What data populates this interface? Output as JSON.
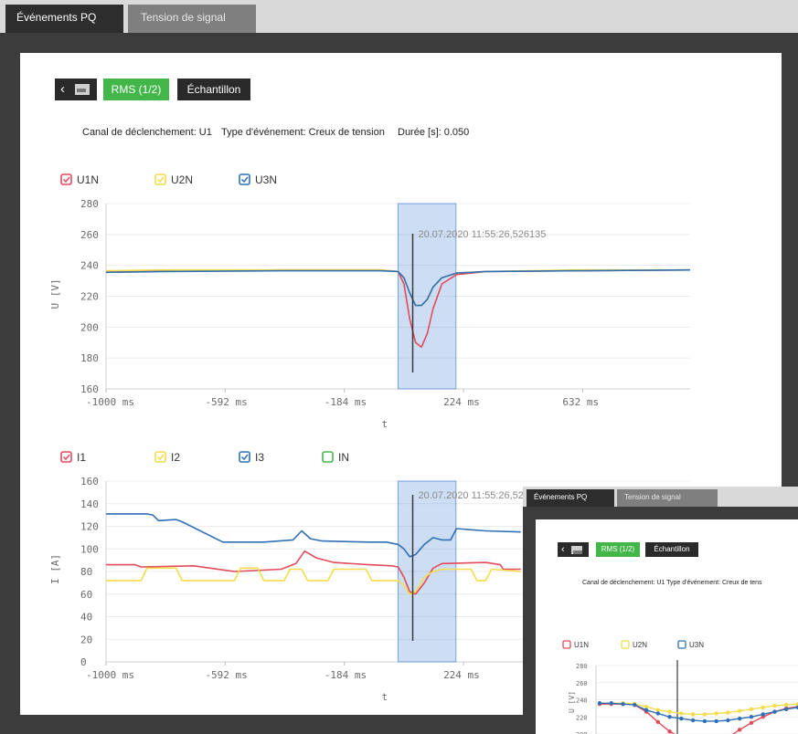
{
  "tabs": [
    {
      "label": "Événements PQ",
      "active": true
    },
    {
      "label": "Tension de signal",
      "active": false
    }
  ],
  "toolbar": {
    "rms_label": "RMS (1/2)",
    "sample_label": "Échantillon"
  },
  "info": {
    "trigger_channel": "Canal de déclenchement: U1",
    "event_type": "Type d'événement: Creux de tension",
    "duration": "Durée [s]: 0.050"
  },
  "colors": {
    "u1n": "#e34a5a",
    "u2n": "#f4dc4a",
    "u3n": "#2f6fb5",
    "in": "#46b649",
    "highlight": "#4a86d8"
  },
  "chart_data": [
    {
      "type": "line",
      "legend": [
        "U1N",
        "U2N",
        "U3N"
      ],
      "ylabel": "U [V]",
      "xlabel": "t",
      "ylim": [
        160,
        280
      ],
      "yticks": [
        160,
        180,
        200,
        220,
        240,
        260,
        280
      ],
      "xlim": [
        -1000,
        1000
      ],
      "xticks": [
        "-1000 ms",
        "-592 ms",
        "-184 ms",
        "224 ms",
        "632 ms"
      ],
      "xtick_values": [
        -1000,
        -592,
        -184,
        224,
        632
      ],
      "highlight_x": [
        0,
        198
      ],
      "annotation": "20.07.2020 11:55:26,526135",
      "series": [
        {
          "name": "U1N",
          "x": [
            -1000,
            -800,
            -400,
            -60,
            0,
            20,
            40,
            60,
            80,
            100,
            120,
            150,
            200,
            300,
            600,
            1000
          ],
          "values": [
            236,
            236.5,
            237,
            237,
            236,
            228,
            205,
            190,
            187,
            196,
            212,
            228,
            234,
            236,
            236.5,
            237
          ]
        },
        {
          "name": "U2N",
          "x": [
            -1000,
            -800,
            -400,
            -60,
            0,
            20,
            40,
            60,
            80,
            100,
            120,
            150,
            200,
            300,
            600,
            1000
          ],
          "values": [
            236.5,
            237,
            237,
            237,
            236,
            232,
            222,
            214,
            214,
            218,
            226,
            232,
            235,
            236,
            237,
            237
          ]
        },
        {
          "name": "U3N",
          "x": [
            -1000,
            -800,
            -400,
            -60,
            0,
            20,
            40,
            60,
            80,
            100,
            120,
            150,
            200,
            300,
            600,
            1000
          ],
          "values": [
            235.5,
            236,
            236.5,
            236.5,
            236,
            232,
            222,
            214,
            214,
            218,
            226,
            232,
            235,
            236,
            236.5,
            237
          ]
        }
      ]
    },
    {
      "type": "line",
      "legend": [
        "I1",
        "I2",
        "I3",
        "IN"
      ],
      "ylabel": "I [A]",
      "xlabel": "t",
      "ylim": [
        0,
        160
      ],
      "yticks": [
        0,
        20,
        40,
        60,
        80,
        100,
        120,
        140,
        160
      ],
      "xlim": [
        -1000,
        1000
      ],
      "xticks": [
        "-1000 ms",
        "-592 ms",
        "-184 ms",
        "224 ms"
      ],
      "xtick_values": [
        -1000,
        -592,
        -184,
        224
      ],
      "highlight_x": [
        0,
        198
      ],
      "annotation": "20.07.2020 11:55:26,526",
      "series": [
        {
          "name": "I1",
          "x": [
            -1000,
            -900,
            -880,
            -700,
            -560,
            -400,
            -350,
            -320,
            -280,
            -220,
            -100,
            -20,
            0,
            20,
            40,
            60,
            90,
            120,
            150,
            300,
            350,
            360,
            420
          ],
          "values": [
            86,
            86,
            84,
            85,
            80,
            82,
            87,
            98,
            92,
            88,
            86,
            85,
            84,
            75,
            62,
            60,
            70,
            83,
            87,
            88,
            86,
            82,
            82
          ]
        },
        {
          "name": "I2",
          "x": [
            -1000,
            -880,
            -860,
            -760,
            -740,
            -560,
            -540,
            -480,
            -460,
            -390,
            -370,
            -330,
            -310,
            -240,
            -220,
            -110,
            -90,
            -20,
            0,
            20,
            40,
            60,
            90,
            120,
            150,
            250,
            270,
            300,
            320,
            420
          ],
          "values": [
            72,
            72,
            83,
            83,
            72,
            72,
            83,
            83,
            72,
            72,
            82,
            82,
            72,
            72,
            82,
            82,
            72,
            72,
            72,
            68,
            60,
            62,
            75,
            80,
            82,
            82,
            72,
            72,
            82,
            80
          ]
        },
        {
          "name": "I3",
          "x": [
            -1000,
            -860,
            -840,
            -820,
            -760,
            -740,
            -600,
            -460,
            -360,
            -330,
            -300,
            -260,
            -100,
            -40,
            0,
            20,
            40,
            60,
            90,
            120,
            150,
            180,
            200,
            300,
            420
          ],
          "values": [
            131,
            131,
            130,
            125,
            126,
            124,
            106,
            106,
            108,
            116,
            109,
            107,
            106,
            106,
            104,
            100,
            93,
            95,
            104,
            110,
            108,
            108,
            118,
            116,
            115
          ]
        }
      ]
    }
  ],
  "inset": {
    "tabs": [
      {
        "label": "Événements PQ"
      },
      {
        "label": "Tension de signal"
      }
    ],
    "toolbar": {
      "rms_label": "RMS (1/2)",
      "sample_label": "Échantillon"
    },
    "info": "Canal de déclenchement: U1    Type d'événement: Creux de tens",
    "chart_data": {
      "type": "line",
      "legend": [
        "U1N",
        "U2N",
        "U3N"
      ],
      "ylabel": "U [V]",
      "ylim": [
        200,
        280
      ],
      "yticks": [
        200,
        220,
        240,
        260,
        280
      ],
      "series": [
        {
          "name": "U1N",
          "values": [
            235,
            235,
            235,
            234,
            226,
            214,
            203,
            195,
            190,
            188,
            190,
            196,
            205,
            213,
            220,
            226,
            230,
            232
          ]
        },
        {
          "name": "U2N",
          "values": [
            236,
            236,
            236,
            235,
            232,
            228,
            226,
            224,
            223,
            223,
            224,
            225,
            227,
            229,
            231,
            233,
            234,
            235
          ]
        },
        {
          "name": "U3N",
          "values": [
            236,
            236,
            235,
            234,
            228,
            224,
            220,
            218,
            216,
            215,
            215,
            216,
            218,
            220,
            223,
            226,
            229,
            231
          ]
        }
      ]
    }
  }
}
